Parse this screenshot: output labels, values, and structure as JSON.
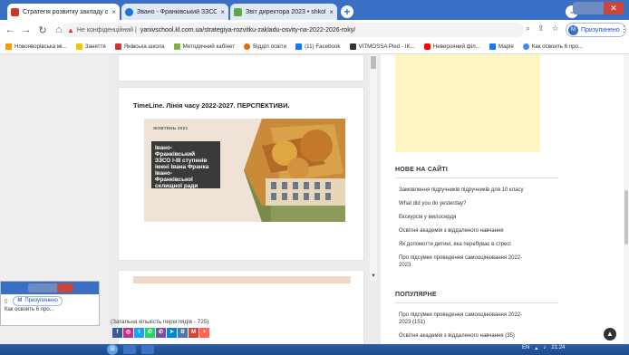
{
  "browser": {
    "tabs": [
      {
        "label": "Стратегія розвитку закладу осв",
        "favicon": "#c93a2c",
        "active": true
      },
      {
        "label": "Звано - Франківський ЗЗСО І - ІІ",
        "favicon": "#1a73e8",
        "active": false
      },
      {
        "label": "Звіт директора 2023 • shkolayan",
        "favicon": "#5ca845",
        "active": false
      }
    ],
    "new_tab": "+",
    "close_glyph": "×",
    "address": {
      "security_label": "Не конфіденційний",
      "url": "yanivschool.kl.com.ua/strategiya-rozvitku-zakladu-osvity-na-2022-2026-roky/"
    },
    "profile_initial": "M",
    "sync_label": "Призупинено",
    "bookmarks": [
      {
        "label": "Новояворівська мі...",
        "color": "#f4a000"
      },
      {
        "label": "Заняття",
        "color": "#f2c500"
      },
      {
        "label": "Янівська школа",
        "color": "#c93a2c"
      },
      {
        "label": "Методичний кабінет",
        "color": "#7db346"
      },
      {
        "label": "Відділ освіти",
        "color": "#e06a10"
      },
      {
        "label": "(11) Facebook",
        "color": "#1877f2"
      },
      {
        "label": "VITMOSSA Pled - IK...",
        "color": "#333333"
      },
      {
        "label": "Неверояний філ...",
        "color": "#ff0000"
      },
      {
        "label": "Марія",
        "color": "#1877f2"
      },
      {
        "label": "Как освоить 6 про...",
        "color": "#4285f4"
      }
    ]
  },
  "article": {
    "heading": "TimeLine. Лінія часу 2022-2027. ПЕРСПЕКТИВИ.",
    "banner_date": "ЖОВТЕНЬ 2021",
    "banner_lines": [
      "Івано-",
      "Франківський",
      "ЗЗСО І-ІІІ ступенів",
      "імені Івана Франка",
      "Івано-",
      "Франківської",
      "селищної ради"
    ],
    "view_count": "(Загальна кількість переглядів - 725)"
  },
  "sidebar": {
    "new_title": "НОВЕ НА САЙТІ",
    "new_items": [
      "Замовлення підручників підручників для 10 класу",
      "What did you do yesterday?",
      "Екскурсія у милосердя",
      "Освітня академія з віддаленого навчання",
      "Як допомогти дитині, яка перебуває в стресі",
      "Про підсумки проведення самооцінювання 2022-2023"
    ],
    "popular_title": "ПОПУЛЯРНЕ",
    "popular_items": [
      "Про підсумки проведення самооцінювання 2022-2023 (151)",
      "Освітня академія з віддаленого навчання (35)"
    ]
  },
  "second_window": {
    "sync_label": "Призупинено",
    "bookmark": "Как освоить 6 про...",
    "profile_initial": "M"
  },
  "share_buttons": [
    {
      "glyph": "f",
      "color": "#3b5998"
    },
    {
      "glyph": "◎",
      "color": "#c13584"
    },
    {
      "glyph": "t",
      "color": "#1da1f2"
    },
    {
      "glyph": "✆",
      "color": "#25d366"
    },
    {
      "glyph": "✆",
      "color": "#7b519d"
    },
    {
      "glyph": "➤",
      "color": "#0088cc"
    },
    {
      "glyph": "В",
      "color": "#4a76a8"
    },
    {
      "glyph": "M",
      "color": "#d44638"
    },
    {
      "glyph": "+",
      "color": "#ff6550"
    }
  ],
  "taskbar": {
    "lang": "EN",
    "time": "21:24"
  }
}
